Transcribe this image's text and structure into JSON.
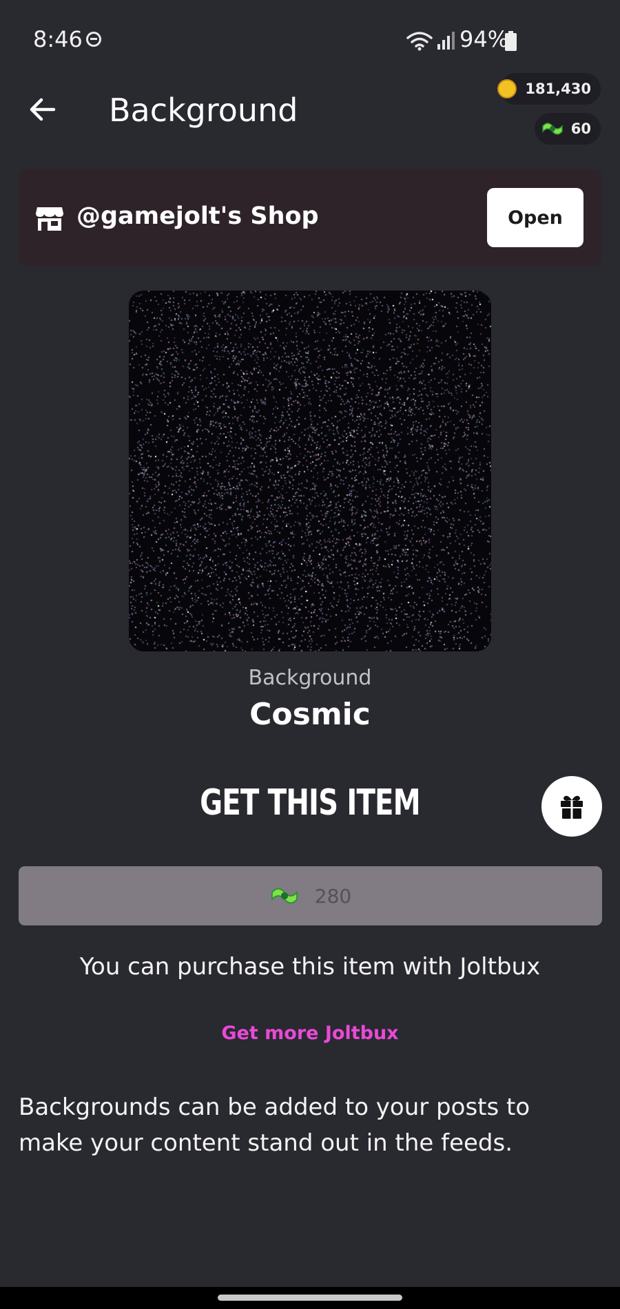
{
  "status_bar": {
    "time": "8:46",
    "battery": "94%",
    "icons": [
      "do-not-disturb-icon",
      "wifi-icon",
      "signal-icon",
      "battery-icon"
    ]
  },
  "header": {
    "title": "Background",
    "coins": "181,430",
    "joltbux": "60",
    "icons": [
      "back-arrow-icon",
      "coin-icon",
      "joltbux-icon"
    ]
  },
  "shop": {
    "name": "@gamejolt's Shop",
    "open_label": "Open",
    "icon": "store-icon"
  },
  "item": {
    "type": "Background",
    "name": "Cosmic"
  },
  "purchase": {
    "heading": "GET THIS ITEM",
    "price": "280",
    "note": "You can purchase this item with Joltbux",
    "more_link": "Get more Joltbux",
    "gift_icon": "gift-icon"
  },
  "description": "Backgrounds can be added to your posts to make your content stand out in the feeds.",
  "colors": {
    "background": "#292930",
    "shop_card": "#2e2329",
    "price_button": "#817c84",
    "link": "#e84ad6"
  }
}
